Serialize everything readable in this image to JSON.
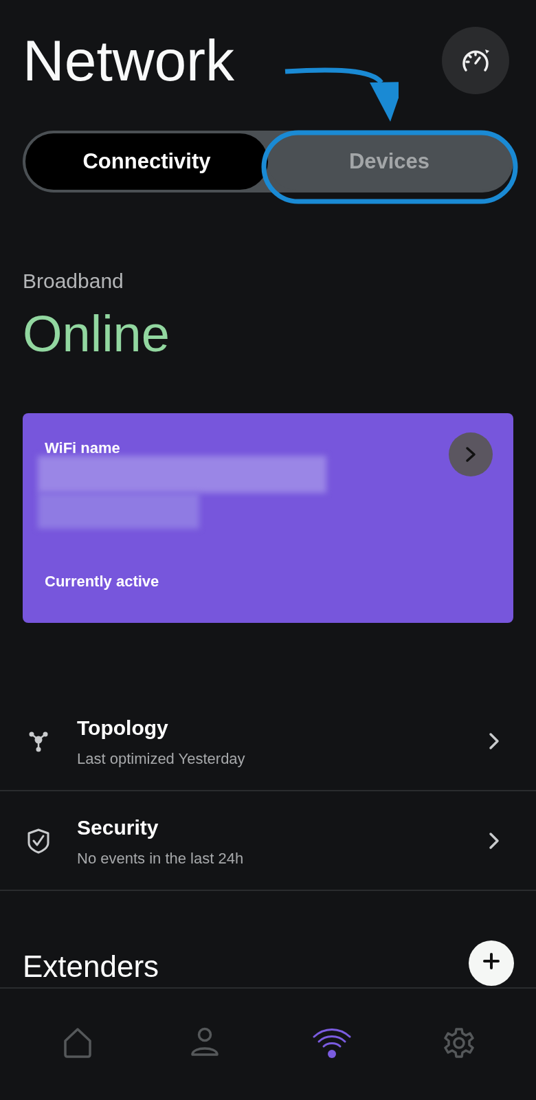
{
  "header": {
    "title": "Network"
  },
  "tabs": [
    {
      "label": "Connectivity",
      "selected": true
    },
    {
      "label": "Devices",
      "selected": false
    }
  ],
  "status": {
    "label": "Broadband",
    "value": "Online"
  },
  "wifi_card": {
    "label": "WiFi name",
    "footer": "Currently active"
  },
  "list": [
    {
      "kind": "topology",
      "title": "Topology",
      "subtitle": "Last optimized Yesterday"
    },
    {
      "kind": "security",
      "title": "Security",
      "subtitle": "No events in the last 24h"
    }
  ],
  "extenders": {
    "title": "Extenders"
  },
  "nav": [
    {
      "kind": "home",
      "selected": false
    },
    {
      "kind": "profile",
      "selected": false
    },
    {
      "kind": "wifi",
      "selected": true
    },
    {
      "kind": "settings",
      "selected": false
    }
  ]
}
